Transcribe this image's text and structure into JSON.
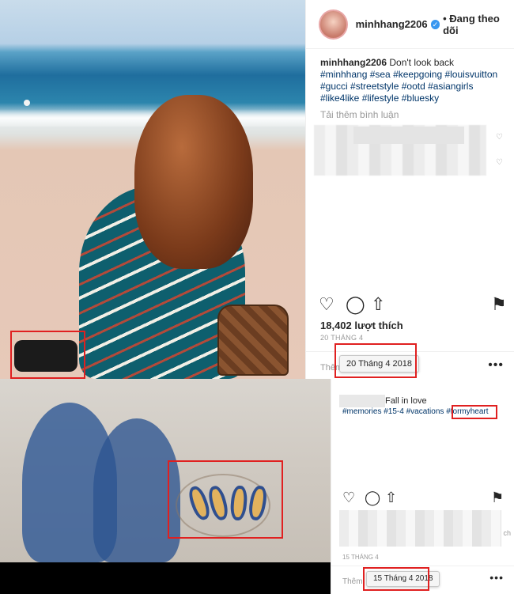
{
  "top_post": {
    "username": "minhhang2206",
    "follow_status": "• Đang theo dõi",
    "caption_text": "Don't look back",
    "hashtags_line1": "#minhhang #sea #keepgoing #louisvuitton",
    "hashtags_line2": "#gucci #streetstyle #ootd #asiangirls",
    "hashtags_line3": "#like4like #lifestyle #bluesky",
    "load_more_comments": "Tải thêm bình luận",
    "likes": "18,402 lượt thích",
    "date_small": "20 THÁNG 4",
    "comment_placeholder": "Thêm",
    "date_tooltip": "20 Tháng 4 2018",
    "more_icon": "•••"
  },
  "bottom_post": {
    "caption_text": "Fall in love",
    "hashtags": "#memories #15-4 #vacations",
    "hashtag_highlight": "#formyheart",
    "date_small": "15 THÁNG 4",
    "comment_placeholder": "Thêm",
    "date_tooltip": "15 Tháng 4 2018",
    "edge_text": "ch",
    "more_icon": "•••"
  },
  "icons": {
    "heart": "♡",
    "comment": "◯",
    "share": "⇧",
    "bookmark": "⚑"
  },
  "colors": {
    "hashtag": "#003569",
    "highlight_box": "#e02020",
    "verified": "#3897f0"
  }
}
